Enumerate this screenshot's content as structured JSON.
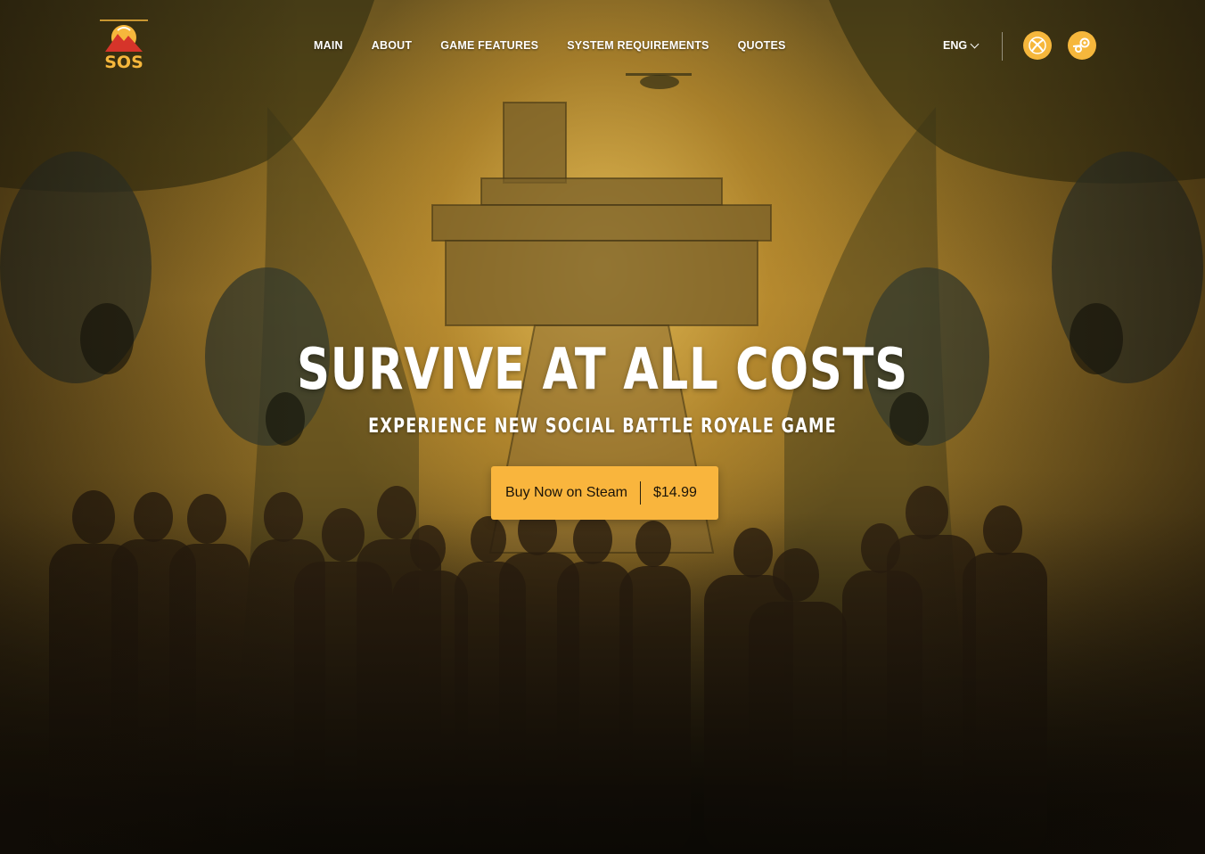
{
  "brand": {
    "logo_text": "SOS",
    "accent_color": "#f6b73c",
    "logo_red": "#d6342a"
  },
  "nav": {
    "items": [
      {
        "label": "MAIN"
      },
      {
        "label": "ABOUT"
      },
      {
        "label": "GAME FEATURES"
      },
      {
        "label": "SYSTEM REQUIREMENTS"
      },
      {
        "label": "QUOTES"
      }
    ]
  },
  "header": {
    "language": "ENG",
    "platforms": [
      {
        "icon": "xbox-icon"
      },
      {
        "icon": "steam-icon"
      }
    ]
  },
  "hero": {
    "headline": "SURVIVE AT ALL COSTS",
    "subheadline": "EXPERIENCE NEW SOCIAL BATTLE ROYALE GAME",
    "cta": {
      "label": "Buy Now on Steam",
      "price": "$14.99",
      "color": "#f9b53d"
    }
  }
}
